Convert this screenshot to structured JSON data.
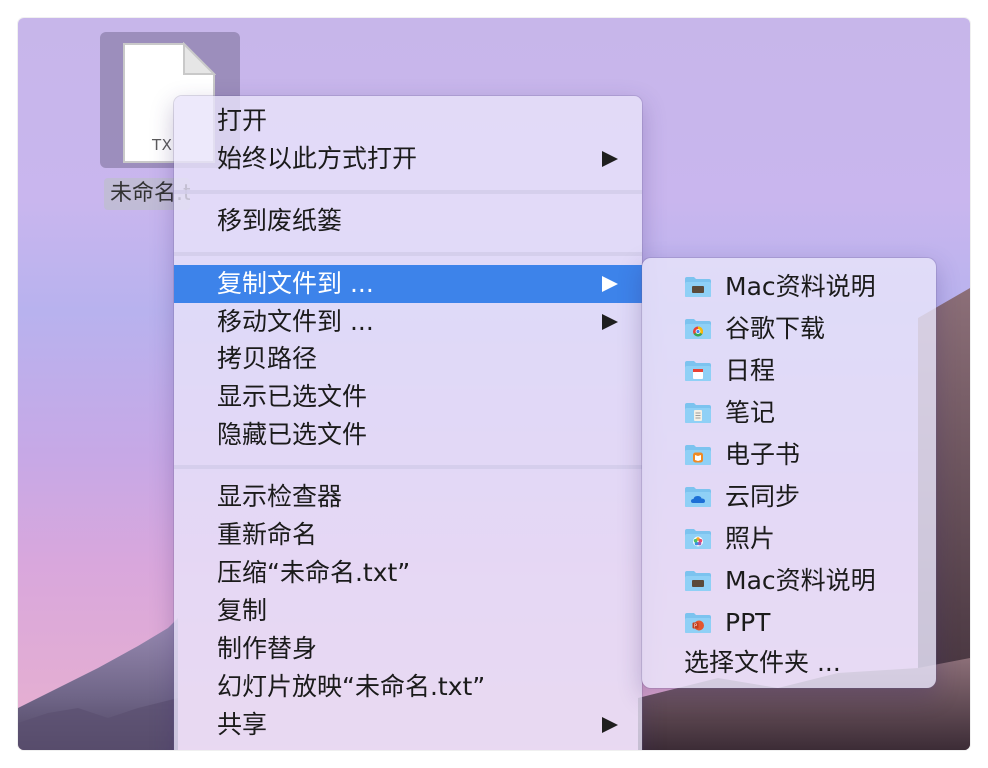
{
  "desktop": {
    "file": {
      "icon": "text-document-icon",
      "extension_label": "TX",
      "name": "未命名.txt"
    }
  },
  "context_menu": {
    "groups": [
      [
        {
          "label": "打开",
          "submenu": false
        },
        {
          "label": "始终以此方式打开",
          "submenu": true
        }
      ],
      [
        {
          "label": "移到废纸篓",
          "submenu": false
        }
      ],
      [
        {
          "label": "复制文件到 ...",
          "submenu": true,
          "highlighted": true
        },
        {
          "label": "移动文件到 ...",
          "submenu": true
        },
        {
          "label": "拷贝路径",
          "submenu": false
        },
        {
          "label": "显示已选文件",
          "submenu": false
        },
        {
          "label": "隐藏已选文件",
          "submenu": false
        }
      ],
      [
        {
          "label": "显示检查器",
          "submenu": false
        },
        {
          "label": "重新命名",
          "submenu": false
        },
        {
          "label": "压缩“未命名.txt”",
          "submenu": false
        },
        {
          "label": "复制",
          "submenu": false
        },
        {
          "label": "制作替身",
          "submenu": false
        },
        {
          "label": "幻灯片放映“未命名.txt”",
          "submenu": false
        },
        {
          "label": "共享",
          "submenu": true
        }
      ]
    ]
  },
  "copy_to_submenu": {
    "items": [
      {
        "label": "Mac资料说明",
        "icon": "folder-icon"
      },
      {
        "label": "谷歌下载",
        "icon": "chrome-folder-icon"
      },
      {
        "label": "日程",
        "icon": "calendar-folder-icon"
      },
      {
        "label": "笔记",
        "icon": "notes-folder-icon"
      },
      {
        "label": "电子书",
        "icon": "books-folder-icon"
      },
      {
        "label": "云同步",
        "icon": "cloud-folder-icon"
      },
      {
        "label": "照片",
        "icon": "photos-folder-icon"
      },
      {
        "label": "Mac资料说明",
        "icon": "folder-icon"
      },
      {
        "label": "PPT",
        "icon": "powerpoint-folder-icon"
      }
    ],
    "choose_folder": "选择文件夹 ..."
  },
  "colors": {
    "highlight": "#3d83ea",
    "folder": "#7cc3ef"
  }
}
